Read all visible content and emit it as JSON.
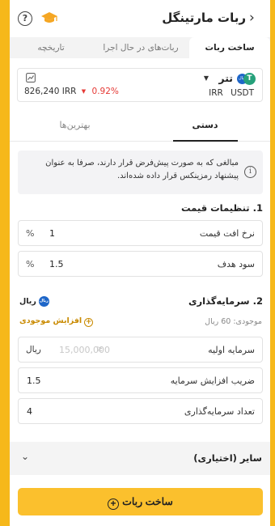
{
  "header": {
    "title": "ربات مارتینگل",
    "back_icon": "chevron-right-icon",
    "help_icon": "question-icon",
    "cap_icon": "graduation-cap-icon"
  },
  "tabs": [
    {
      "label": "ساخت ربات",
      "active": true
    },
    {
      "label": "ربات‌های در حال اجرا",
      "active": false
    },
    {
      "label": "تاریخچه",
      "active": false
    }
  ],
  "market": {
    "name": "تتر",
    "base": "USDT",
    "quote": "IRR",
    "price": "826,240 IRR",
    "change": "0.92%",
    "change_color": "#e53935"
  },
  "mode_tabs": [
    {
      "label": "دستی",
      "active": true
    },
    {
      "label": "بهترین‌ها",
      "active": false
    }
  ],
  "info": {
    "text": "مبالغی که به صورت پیش‌فرض قرار دارند، صرفا به عنوان پیشنهاد رمزینکس قرار داده شده‌اند."
  },
  "price_settings": {
    "title": "1. تنظیمات قیمت",
    "drop_rate": {
      "label": "نرخ افت قیمت",
      "value": "1",
      "unit": "%"
    },
    "target_profit": {
      "label": "سود هدف",
      "value": "1.5",
      "unit": "%"
    }
  },
  "investment": {
    "title": "2. سرمایه‌گذاری",
    "currency_badge": "ریال",
    "balance": "موجودی: 60 ریال",
    "increase_label": "افزایش موجودی",
    "initial": {
      "label": "سرمایه اولیه",
      "placeholder": "15,000,000",
      "lte": "≤",
      "unit": "ریال"
    },
    "multiplier": {
      "label": "ضریب افزایش سرمایه",
      "value": "1.5"
    },
    "count": {
      "label": "تعداد سرمایه‌گذاری",
      "value": "4"
    }
  },
  "other": {
    "label": "سایر (اختیاری)"
  },
  "create_button": {
    "label": "ساخت ربات"
  },
  "colors": {
    "accent": "#fbc02d",
    "background": "#f6b81a",
    "negative": "#e53935"
  }
}
